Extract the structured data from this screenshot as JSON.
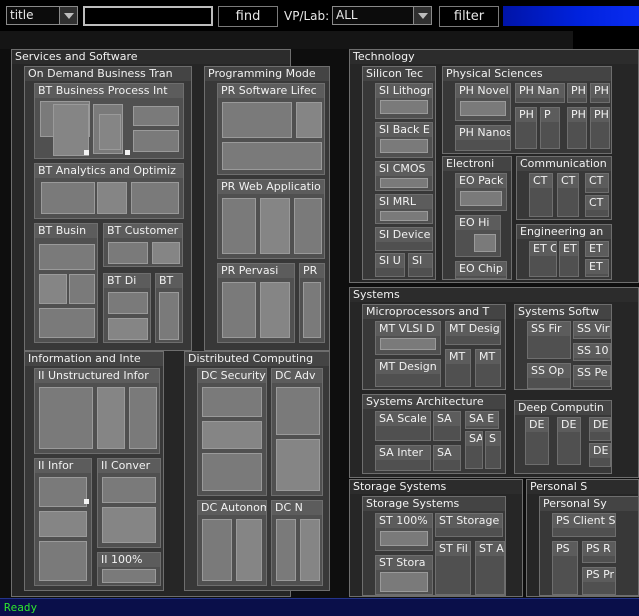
{
  "toolbar": {
    "field_select": {
      "value": "title"
    },
    "search_value": "",
    "find_label": "find",
    "vp_lab_label": "VP/Lab:",
    "vp_lab_select": {
      "value": "ALL"
    },
    "filter_label": "filter",
    "progress_fraction": 1.0
  },
  "status": {
    "text": "Ready"
  },
  "treemap": {
    "services": {
      "label": "Services and Software",
      "on_demand": {
        "label": "On Demand Business Tran",
        "bt_process": "BT Business Process Int",
        "bt_analytics": "BT Analytics and Optimiz",
        "bt_busin": "BT Busin",
        "bt_customer": "BT Customer",
        "bt_di": "BT Di",
        "bt": "BT"
      },
      "programming": {
        "label": "Programming Mode",
        "pr_lifecycle": "PR Software Lifec",
        "pr_web": "PR Web Applicatio",
        "pr_pervasive": "PR Pervasi",
        "pr": "PR"
      },
      "information": {
        "label": "Information and Inte",
        "ii_unstructured": "II Unstructured Infor",
        "ii_infor": "II Infor",
        "ii_conver": "II Conver",
        "ii_100": "II 100%"
      },
      "distributed": {
        "label": "Distributed Computing",
        "dc_security": "DC Security",
        "dc_adv": "DC Adv",
        "dc_autonom": "DC Autonom",
        "dc_n": "DC N"
      }
    },
    "technology": {
      "label": "Technology",
      "silicon": {
        "label": "Silicon Tec",
        "si_litho": "SI Lithogr",
        "si_back": "SI Back E",
        "si_cmos": "SI CMOS",
        "si_mrl": "SI MRL",
        "si_device": "SI Device",
        "si_u": "SI U",
        "si": "SI"
      },
      "physical": {
        "label": "Physical Sciences",
        "ph_novel": "PH Novel",
        "ph_nan": "PH Nan",
        "ph_a": "PH",
        "ph_b": "PH",
        "ph_c": "PH",
        "p": "P",
        "ph_d": "PH",
        "ph_e": "PH",
        "ph_nanos": "PH Nanos"
      },
      "electronic": {
        "label": "Electroni",
        "eo_pack": "EO Pack",
        "eo_hi": "EO Hi",
        "eo_chip": "EO Chip"
      },
      "communication": {
        "label": "Communication",
        "ct_a": "CT",
        "ct_b": "CT",
        "ct_c": "CT",
        "ct_d": "CT"
      },
      "engineering": {
        "label": "Engineering an",
        "et_c": "ET C",
        "et_a": "ET",
        "et_b": "ET",
        "et_d": "ET"
      }
    },
    "systems": {
      "label": "Systems",
      "micro": {
        "label": "Microprocessors and T",
        "mt_vlsi": "MT VLSI D",
        "mt_desig": "MT Desig",
        "mt_design": "MT Design",
        "mt_a": "MT",
        "mt_b": "MT"
      },
      "syssoft": {
        "label": "Systems Softw",
        "ss_fir": "SS Fir",
        "ss_virt": "SS Virt",
        "ss_10": "SS 10",
        "ss_op": "SS Op",
        "ss_pe": "SS Pe"
      },
      "sysarch": {
        "label": "Systems Architecture",
        "sa_scale": "SA Scale",
        "sa_a": "SA",
        "sa_e": "SA E",
        "sa_inter": "SA Inter",
        "sa_b": "SA",
        "sa_c": "SA",
        "s": "S"
      },
      "deep": {
        "label": "Deep Computin",
        "de_a": "DE",
        "de_b": "DE",
        "de_c": "DE",
        "de_d": "DE"
      }
    },
    "storage": {
      "label": "Storage Systems",
      "storage_sys": {
        "label": "Storage Systems",
        "st_100": "ST 100%",
        "st_storage": "ST Storage",
        "st_stora": "ST Stora",
        "st_fil": "ST Fil",
        "st_a": "ST A"
      }
    },
    "personal": {
      "label": "Personal S",
      "personal_sy": {
        "label": "Personal Sy",
        "ps_client": "PS Client S",
        "ps": "PS",
        "ps_r": "PS R",
        "ps_pr": "PS Pr"
      }
    }
  },
  "colors": {
    "background": "#000000",
    "status_bar": "#0a0f4a",
    "status_text": "#2ee62e",
    "progress": "#0022dd"
  }
}
